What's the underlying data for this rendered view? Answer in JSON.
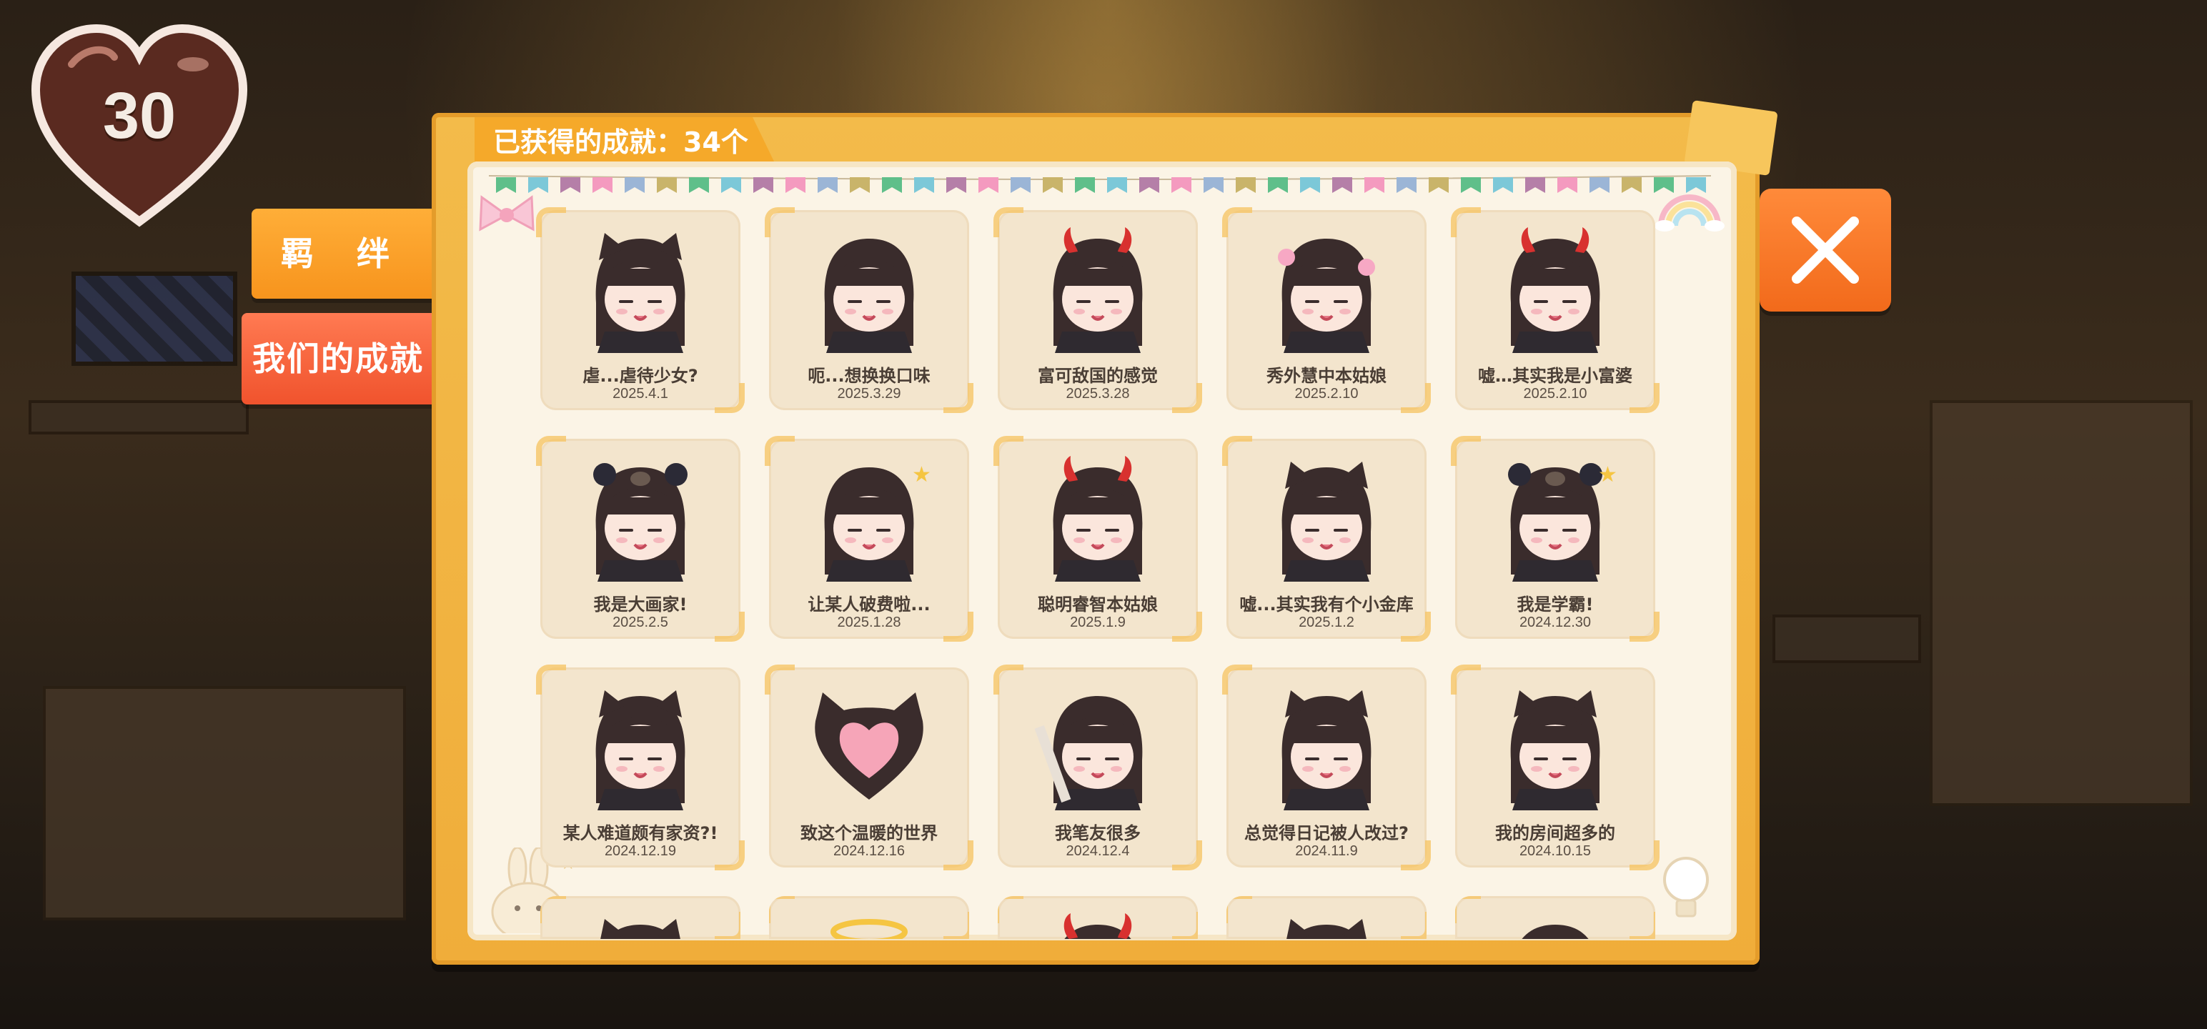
{
  "hud": {
    "affection_count": "30"
  },
  "side_tabs": {
    "bond": "羁 绊",
    "achievements": "我们的成就"
  },
  "board": {
    "header": "已获得的成就：34个"
  },
  "achievements": [
    {
      "title": "虐...虐待少女?",
      "date": "2025.4.1",
      "icon": "cat-ear-girl-crying-icon"
    },
    {
      "title": "呃...想换换口味",
      "date": "2025.3.29",
      "icon": "girl-gloomy-icon"
    },
    {
      "title": "富可敌国的感觉",
      "date": "2025.3.28",
      "icon": "devil-girl-laughing-icon"
    },
    {
      "title": "秀外慧中本姑娘",
      "date": "2025.2.10",
      "icon": "girl-flowers-icon"
    },
    {
      "title": "嘘…其实我是小富婆",
      "date": "2025.2.10",
      "icon": "devil-girl-wink-icon"
    },
    {
      "title": "我是大画家!",
      "date": "2025.2.5",
      "icon": "bear-hood-girl-icon"
    },
    {
      "title": "让某人破费啦...",
      "date": "2025.1.28",
      "icon": "girl-sparkle-icon"
    },
    {
      "title": "聪明睿智本姑娘",
      "date": "2025.1.9",
      "icon": "devil-girl-blush-icon"
    },
    {
      "title": "嘘...其实我有个小金库",
      "date": "2025.1.2",
      "icon": "cat-ear-girl-happy-icon"
    },
    {
      "title": "我是学霸!",
      "date": "2024.12.30",
      "icon": "bear-hood-girl-star-icon"
    },
    {
      "title": "某人难道颇有家资?!",
      "date": "2024.12.19",
      "icon": "cat-ear-girl-shocked-icon"
    },
    {
      "title": "致这个温暖的世界",
      "date": "2024.12.16",
      "icon": "cat-heart-icon"
    },
    {
      "title": "我笔友很多",
      "date": "2024.12.4",
      "icon": "girl-brush-icon"
    },
    {
      "title": "总觉得日记被人改过?",
      "date": "2024.11.9",
      "icon": "cat-ear-girl-confused-icon"
    },
    {
      "title": "我的房间超多的",
      "date": "2024.10.15",
      "icon": "cat-ear-girl-wave-icon"
    },
    {
      "title": "",
      "date": "",
      "icon": "cat-ear-girl-icon"
    },
    {
      "title": "",
      "date": "",
      "icon": "halo-icon"
    },
    {
      "title": "",
      "date": "",
      "icon": "devil-girl-icon"
    },
    {
      "title": "",
      "date": "",
      "icon": "cat-ear-girl-icon"
    },
    {
      "title": "",
      "date": "",
      "icon": "girl-icon"
    }
  ],
  "colors": {
    "board": "#f0ad3a",
    "card": "#f3e5cd",
    "tab_bond": "#f7941d",
    "tab_achievements": "#f0532d",
    "close_button": "#f26a1b",
    "hair": "#3a2c2c"
  }
}
